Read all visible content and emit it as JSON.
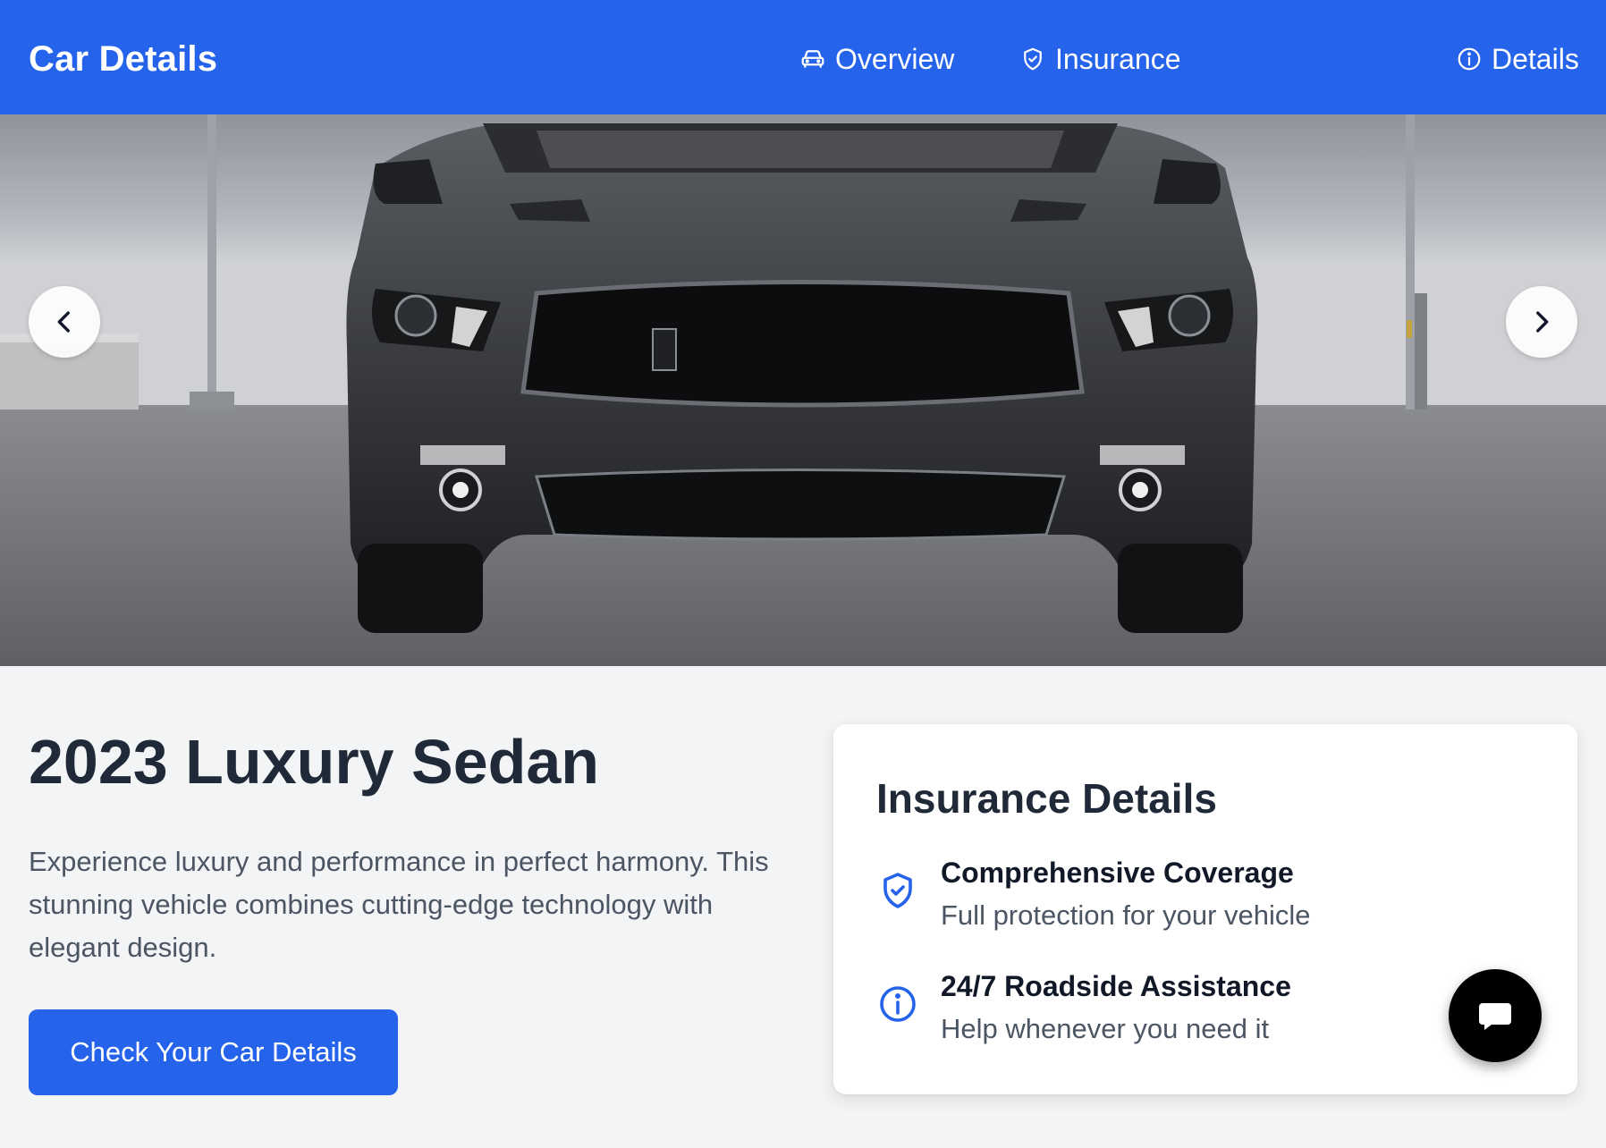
{
  "header": {
    "title": "Car Details",
    "nav": [
      {
        "label": "Overview",
        "icon": "car-icon"
      },
      {
        "label": "Insurance",
        "icon": "shield-check-icon"
      },
      {
        "label": "Details",
        "icon": "info-icon"
      }
    ]
  },
  "hero": {
    "image": "dark-grey-muscle-car-front-view",
    "prev_icon": "chevron-left-icon",
    "next_icon": "chevron-right-icon"
  },
  "main": {
    "title": "2023 Luxury Sedan",
    "description": "Experience luxury and performance in perfect harmony. This stunning vehicle combines cutting-edge technology with elegant design.",
    "cta_label": "Check Your Car Details"
  },
  "insurance": {
    "title": "Insurance Details",
    "features": [
      {
        "title": "Comprehensive Coverage",
        "description": "Full protection for your vehicle",
        "icon": "shield-check-icon"
      },
      {
        "title": "24/7 Roadside Assistance",
        "description": "Help whenever you need it",
        "icon": "info-icon"
      }
    ]
  },
  "chat": {
    "icon": "chat-bubble-icon"
  },
  "colors": {
    "primary": "#2563eb",
    "background": "#f3f4f6",
    "card": "#ffffff",
    "text_dark": "#1f2937",
    "text_muted": "#4b5563"
  }
}
